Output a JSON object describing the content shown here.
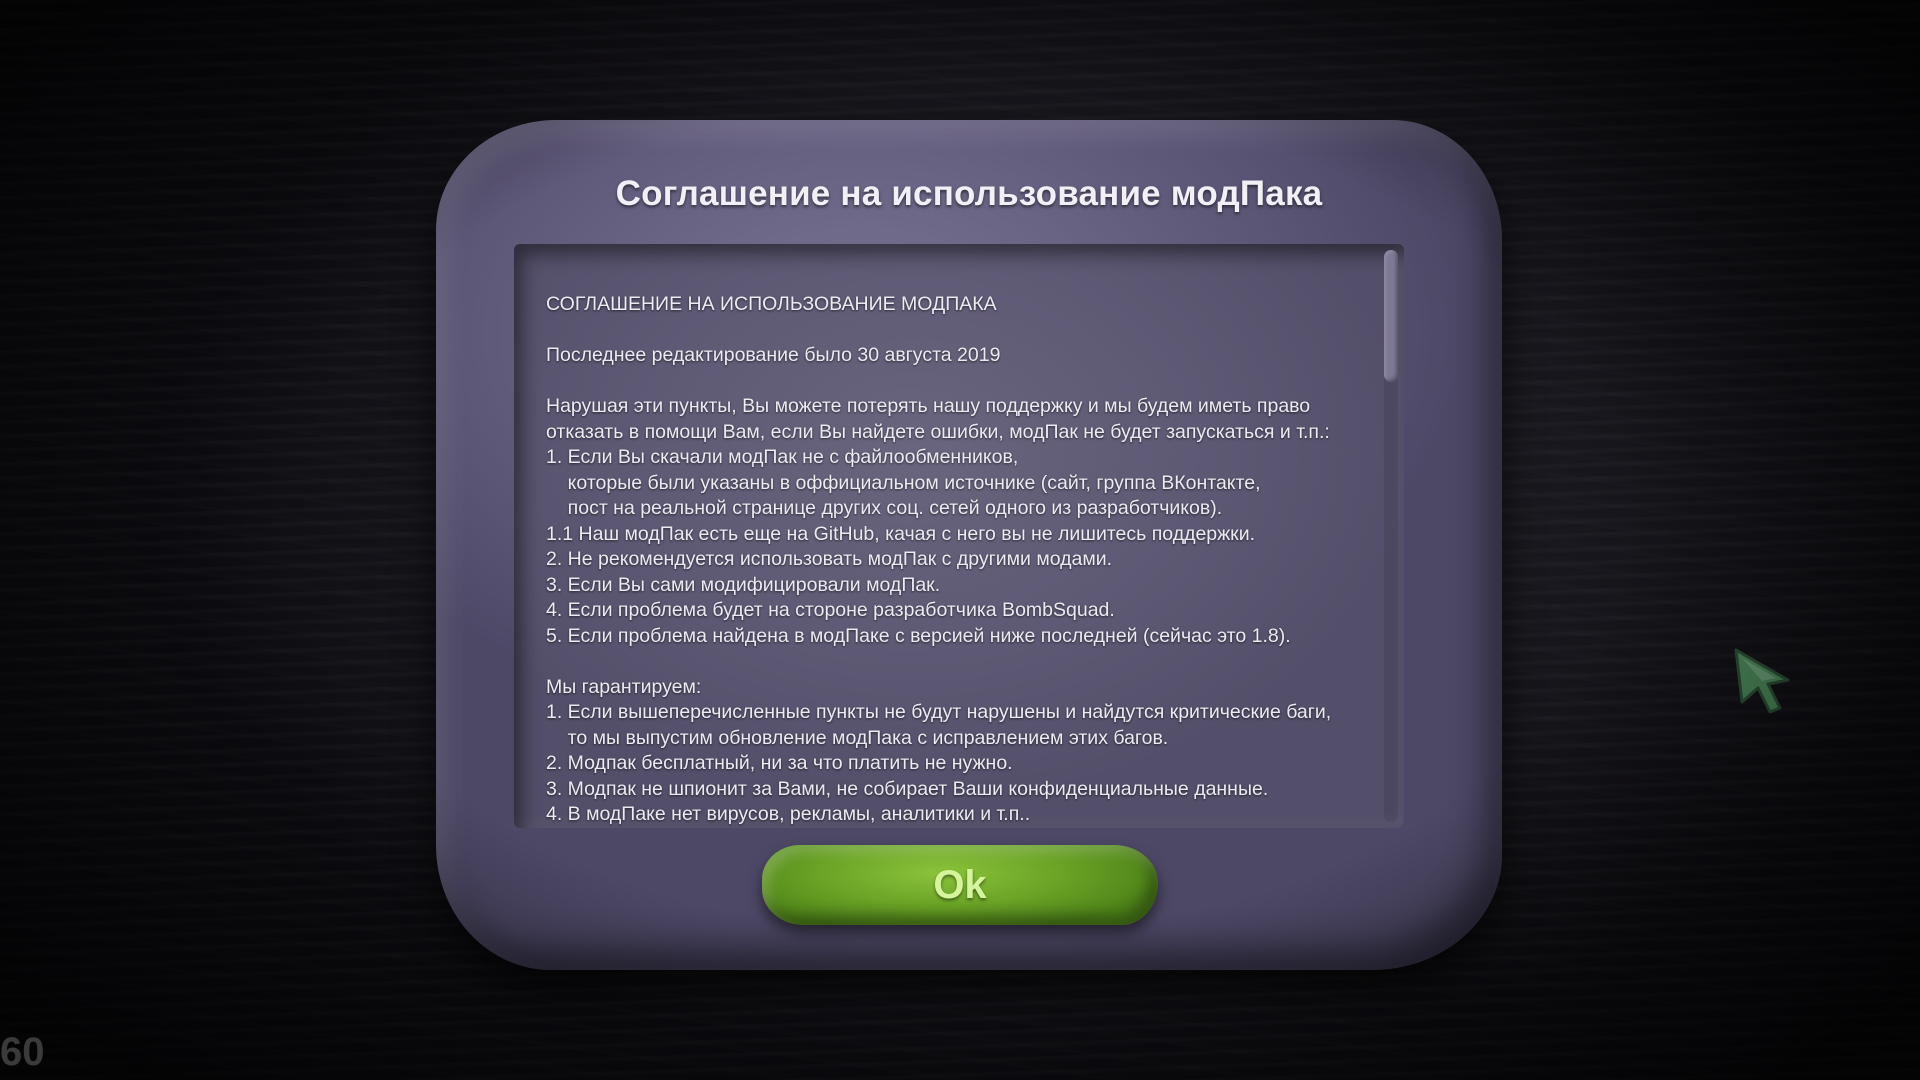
{
  "dialog": {
    "title": "Соглашение на использование модПака",
    "lines": [
      "СОГЛАШЕНИЕ НА ИСПОЛЬЗОВАНИЕ МОДПАКА",
      "",
      "Последнее редактирование было 30 августа 2019",
      "",
      "Нарушая эти пункты, Вы можете потерять нашу поддержку и мы будем иметь право",
      "отказать в помощи Вам, если Вы найдете ошибки, модПак не будет запускаться и т.п.:",
      "1. Если Вы скачали модПак не с файлообменников,",
      "    которые были указаны в оффициальном источнике (сайт, группа ВКонтакте,",
      "    пост на реальной странице других соц. сетей одного из разработчиков).",
      "1.1 Наш модПак есть еще на GitHub, качая с него вы не лишитесь поддержки.",
      "2. Не рекомендуется использовать модПак с другими модами.",
      "3. Если Вы сами модифицировали модПак.",
      "4. Если проблема будет на стороне разработчика BombSquad.",
      "5. Если проблема найдена в модПаке с версией ниже последней (сейчас это 1.8).",
      "",
      "Мы гарантируем:",
      "1. Если вышеперечисленные пункты не будут нарушены и найдутся критические баги,",
      "    то мы выпустим обновление модПака с исправлением этих багов.",
      "2. Модпак бесплатный, ни за что платить не нужно.",
      "3. Модпак не шпионит за Вами, не собирает Ваши конфиденциальные данные.",
      "4. В модПаке нет вирусов, рекламы, аналитики и т.п.."
    ],
    "ok_label": "Ok"
  },
  "scrollbar": {
    "position": 0
  },
  "overlay": {
    "fps": "60"
  },
  "icons": {
    "cursor": "arrow-cursor-icon"
  },
  "colors": {
    "frame": "#6a6484",
    "panel": "#5e5974",
    "ok_button": "#6aa326",
    "ok_text": "#d5f59c",
    "cursor": "#4d8a5b"
  }
}
